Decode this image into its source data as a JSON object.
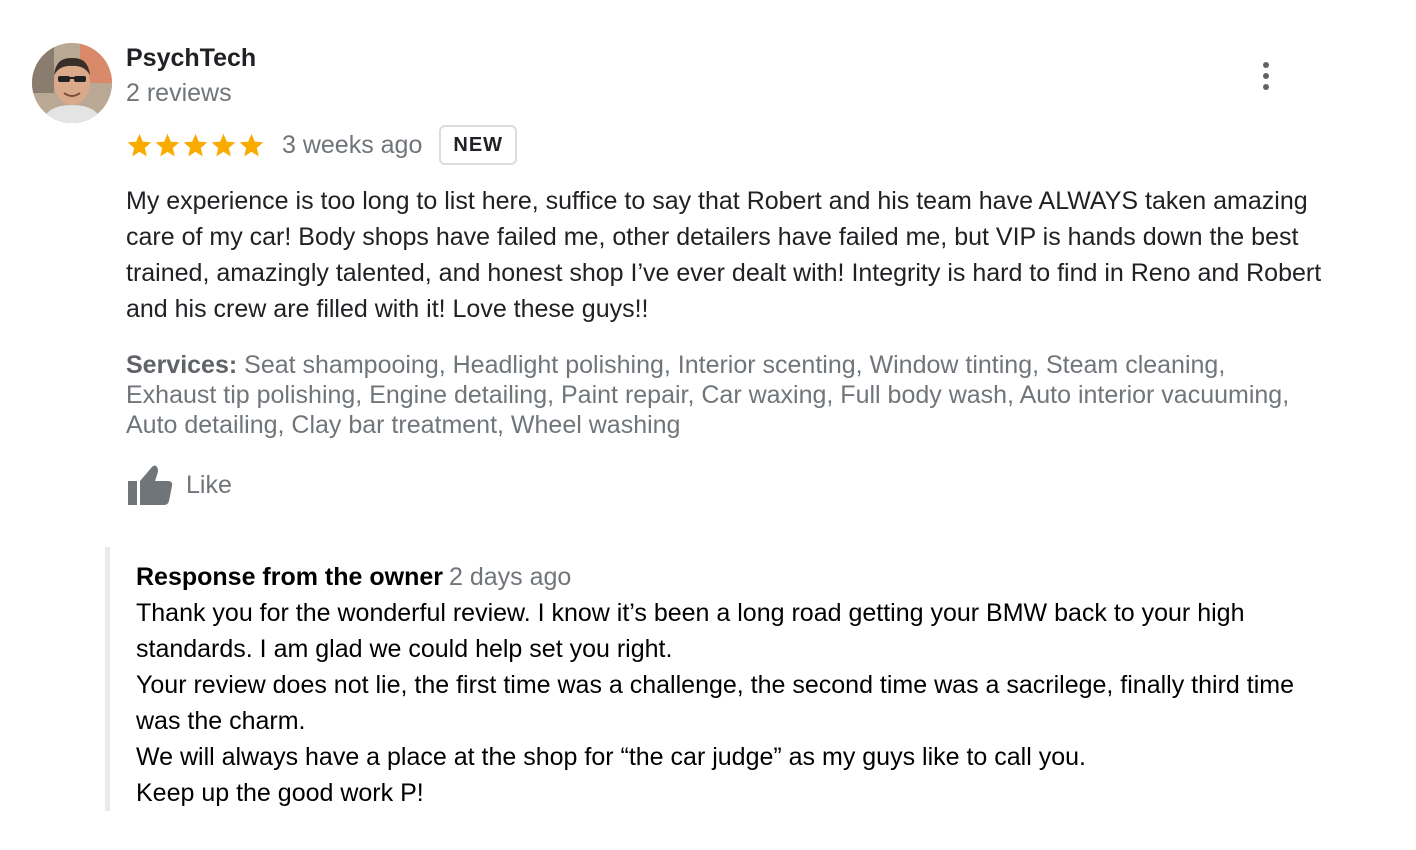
{
  "reviewer": {
    "name": "PsychTech",
    "review_count": "2 reviews",
    "avatar_icon": "user-photo-avatar"
  },
  "rating": {
    "stars": 5,
    "max_stars": 5,
    "star_color": "#f9ab00"
  },
  "timestamp": "3 weeks ago",
  "badge": "NEW",
  "review_text": "My experience is too long to list here, suffice to say that Robert and his team have ALWAYS taken amazing care of my car! Body shops have failed me, other detailers have failed me, but VIP is hands down the best trained, amazingly talented, and honest shop I’ve ever dealt with! Integrity is hard to find in Reno and Robert and his crew are filled with it! Love these guys!!",
  "services": {
    "label": "Services:",
    "text": "Seat shampooing, Headlight polishing, Interior scenting, Window tinting, Steam cleaning, Exhaust tip polishing, Engine detailing, Paint repair, Car waxing, Full body wash, Auto interior vacuuming, Auto detailing, Clay bar treatment, Wheel washing"
  },
  "like": {
    "label": "Like",
    "icon": "thumbs-up-icon"
  },
  "more_menu": {
    "icon": "more-vertical-icon"
  },
  "owner_response": {
    "title": "Response from the owner",
    "timestamp": "2 days ago",
    "paragraphs": [
      "Thank you for the wonderful review. I know it’s been a long road getting your BMW back to your high standards. I am glad we could help set you right.",
      "Your review does not lie, the first time was a challenge, the second time was a sacrilege, finally third time was the charm.",
      "We will always have a place at the shop for “the car judge” as my guys like to call you.",
      "Keep up the good work P!"
    ]
  },
  "colors": {
    "text_primary": "#202124",
    "text_secondary": "#70757a",
    "star": "#f9ab00",
    "response_border": "#e8eaed"
  }
}
